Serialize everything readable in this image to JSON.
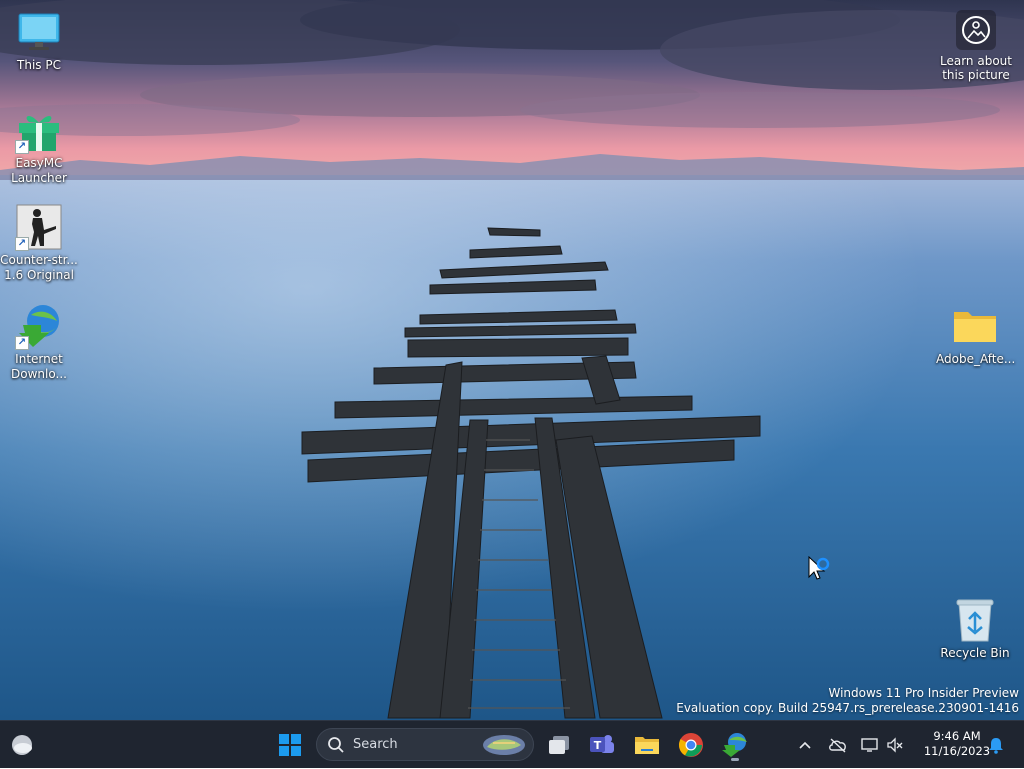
{
  "desktop": {
    "icons_left": [
      {
        "label": "This PC",
        "icon": "monitor-icon"
      },
      {
        "label": "EasyMC Launcher",
        "icon": "gift-icon"
      },
      {
        "label": "Counter-str... 1.6 Original",
        "icon": "counter-strike-icon"
      },
      {
        "label": "Internet Downlo...",
        "icon": "internet-download-manager-icon"
      }
    ],
    "icons_right": [
      {
        "label": "Adobe_Afte...",
        "icon": "folder-icon"
      },
      {
        "label": "Recycle Bin",
        "icon": "recycle-bin-icon"
      }
    ],
    "learn_about": {
      "label": "Learn about this picture",
      "icon": "camera-info-icon"
    }
  },
  "watermark": {
    "line1": "Windows 11 Pro Insider Preview",
    "line2": "Evaluation copy. Build 25947.rs_prerelease.230901-1416"
  },
  "taskbar": {
    "search_placeholder": "Search",
    "apps": [
      {
        "name": "task-view",
        "icon": "task-view-icon"
      },
      {
        "name": "teams",
        "icon": "teams-icon"
      },
      {
        "name": "file-explorer",
        "icon": "folder-icon"
      },
      {
        "name": "chrome",
        "icon": "chrome-icon"
      },
      {
        "name": "internet-download-manager",
        "icon": "internet-download-manager-icon"
      }
    ],
    "clock": {
      "time": "9:46 AM",
      "date": "11/16/2023"
    }
  },
  "colors": {
    "taskbar": "#1f2530",
    "accent": "#0078d4"
  }
}
